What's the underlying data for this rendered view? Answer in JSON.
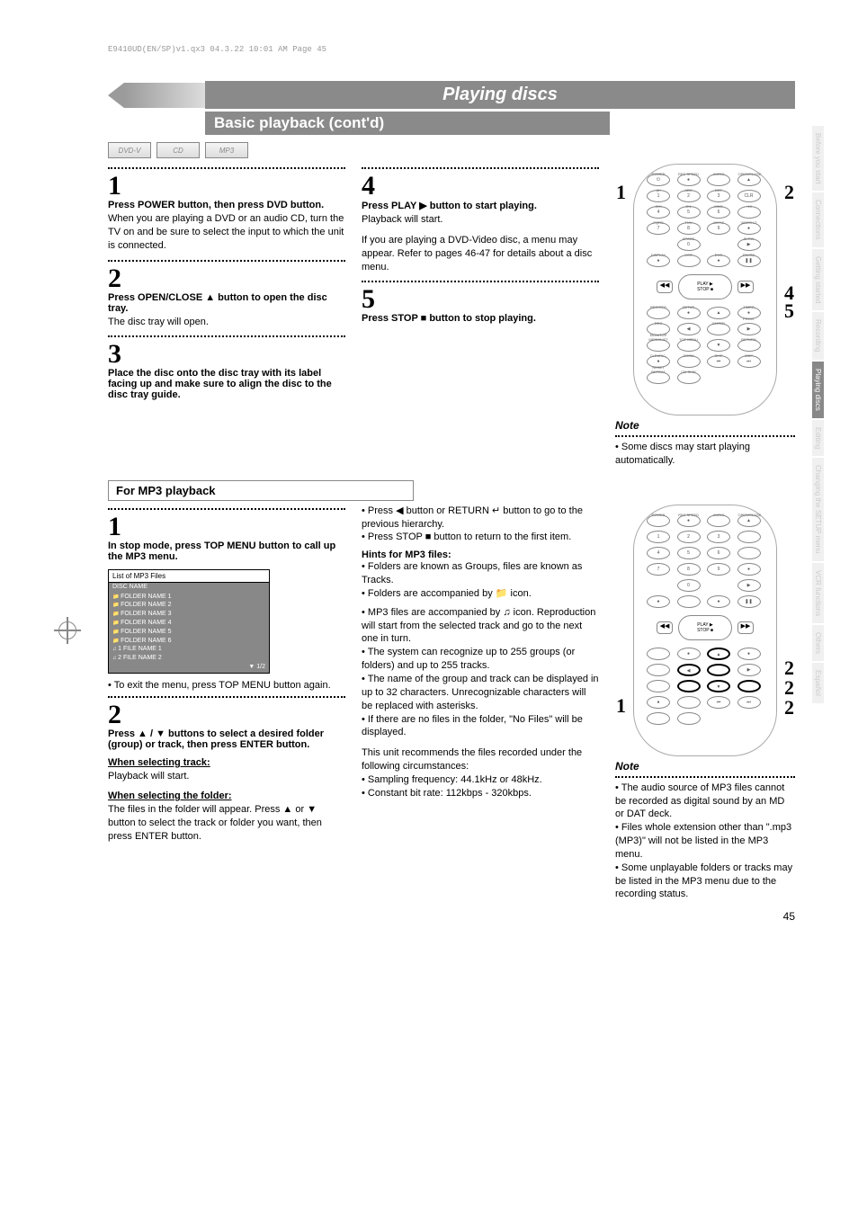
{
  "header": {
    "print_line": "E9410UD(EN/SP)v1.qx3  04.3.22  10:01 AM  Page 45"
  },
  "title": "Playing discs",
  "subtitle": "Basic playback (cont'd)",
  "disc_icons": [
    "DVD-V",
    "CD",
    "MP3"
  ],
  "steps_basic": {
    "s1": {
      "num": "1",
      "head": "Press POWER button, then press DVD button.",
      "body": "When you are playing a DVD or an audio CD, turn the TV on and be sure to select the input to which the unit is connected."
    },
    "s2": {
      "num": "2",
      "head": "Press OPEN/CLOSE ▲ button to open the disc tray.",
      "body": "The disc tray will open."
    },
    "s3": {
      "num": "3",
      "head": "Place the disc onto the disc tray with its label facing up and make sure to align the disc to the disc tray guide.",
      "body": ""
    },
    "s4": {
      "num": "4",
      "head": "Press PLAY ▶ button to start playing.",
      "body1": "Playback will start.",
      "body2": "If you are playing a DVD-Video disc, a menu may appear. Refer to pages 46-47 for details about a disc menu."
    },
    "s5": {
      "num": "5",
      "head": "Press STOP ■ button to stop playing.",
      "body": ""
    }
  },
  "note1": {
    "label": "Note",
    "body": "Some discs may start playing automatically."
  },
  "mp3_section": {
    "title": "For MP3 playback",
    "s1": {
      "num": "1",
      "head": "In stop mode, press TOP MENU button to call up the MP3 menu."
    },
    "screen": {
      "title": "List of MP3 Files",
      "header": "DISC NAME",
      "items": [
        "FOLDER NAME 1",
        "FOLDER NAME 2",
        "FOLDER NAME 3",
        "FOLDER NAME 4",
        "FOLDER NAME 5",
        "FOLDER NAME 6"
      ],
      "files": [
        "1   FILE NAME 1",
        "2   FILE NAME 2"
      ],
      "page": "1/2"
    },
    "exit_note": "To exit the menu, press TOP MENU button again.",
    "s2": {
      "num": "2",
      "head": "Press ▲ / ▼ buttons to select a desired folder (group) or track, then press ENTER button."
    },
    "when_track_h": "When selecting track:",
    "when_track_b": "Playback will start.",
    "when_folder_h": "When selecting the folder:",
    "when_folder_b": "The files in the folder will appear. Press ▲ or ▼ button to select the track or folder you want, then press ENTER button.",
    "col2": {
      "prev": "Press ◀ button or RETURN ↵ button to go to the previous hierarchy.",
      "stop": "Press STOP ■ button to return to the first item.",
      "hints_h": "Hints for MP3 files:",
      "h1": "Folders are known as Groups, files are known as Tracks.",
      "h2": "Folders are accompanied by 📁 icon.",
      "h3": "MP3 files are accompanied by ♫ icon. Reproduction will start from the selected track and go to the next one in turn.",
      "h4": "The system can recognize up to 255 groups (or folders) and up to 255 tracks.",
      "h5": "The name of the group and track can be displayed in up to 32 characters. Unrecognizable characters will be replaced with asterisks.",
      "h6": "If there are no files in the folder, \"No Files\" will be displayed.",
      "rec_intro": "This unit recommends the files recorded under the following circumstances:",
      "rec1": "Sampling frequency: 44.1kHz or 48kHz.",
      "rec2": "Constant bit rate: 112kbps - 320kbps."
    }
  },
  "note2": {
    "label": "Note",
    "b1": "The audio source of MP3 files cannot be recorded as digital sound by an MD or DAT deck.",
    "b2": "Files whole extension other than \".mp3 (MP3)\" will not be listed in the MP3 menu.",
    "b3": "Some unplayable folders or tracks may be listed in the MP3 menu due to the recording status."
  },
  "side_tabs": [
    "Before you start",
    "Connections",
    "Getting started",
    "Recording",
    "Playing discs",
    "Editing",
    "Changing the SETUP menu",
    "VCR functions",
    "Others",
    "Español"
  ],
  "page_num": "45",
  "remote_labels": {
    "row_top": [
      "POWER",
      "REC SPEED",
      "AUDIO",
      "OPEN/CLOSE"
    ],
    "row1": [
      "@!",
      "ABC",
      "DEF",
      ""
    ],
    "row1n": [
      "1",
      "2",
      "3",
      "CLR"
    ],
    "row2": [
      "GHI",
      "JKL",
      "MNO",
      "+10"
    ],
    "row2n": [
      "4",
      "5",
      "6",
      ""
    ],
    "row3": [
      "PQRS",
      "TUV",
      "WXYZ",
      "VIDEO LT"
    ],
    "row3n": [
      "7",
      "8",
      "9",
      ""
    ],
    "row4": [
      "",
      "SPACE",
      "",
      "SLOW"
    ],
    "row4n": [
      "",
      "0",
      "",
      ""
    ],
    "row5": [
      "DISPLAY",
      "VCR",
      "DVD",
      "PAUSE"
    ],
    "mid": {
      "rev": "◀◀",
      "play": "PLAY ▶",
      "stop": "STOP ■",
      "fwd": "▶▶"
    },
    "row6": [
      "REC/OTR",
      "SETUP",
      "",
      "TIMER PROG."
    ],
    "row7": [
      "REC MONITOR",
      "",
      "ENTER",
      ""
    ],
    "row8": [
      "MENU/LIST",
      "TOP MENU",
      "",
      "RETURN"
    ],
    "row9": [
      "CLEAR/C-RESET",
      "ZOOM",
      "SKIP",
      "SKIP"
    ],
    "row10": [
      "REPEAT",
      "",
      "",
      ""
    ],
    "row11": [
      "",
      "CM SKIP",
      "",
      ""
    ]
  },
  "remote_pointers_top": {
    "p1": "1",
    "p2": "2",
    "p4": "4",
    "p5": "5"
  },
  "remote_pointers_bottom": {
    "p1": "1",
    "p2a": "2",
    "p2b": "2",
    "p2c": "2"
  }
}
